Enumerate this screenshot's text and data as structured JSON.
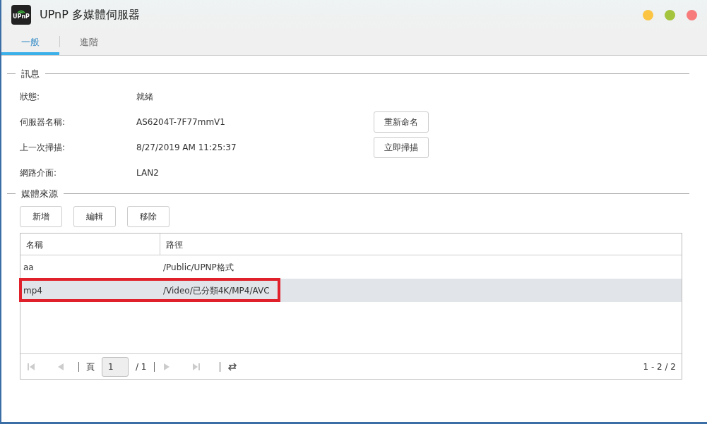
{
  "window": {
    "title": "UPnP 多媒體伺服器",
    "app_icon_text": "UPnP",
    "controls": [
      {
        "color": "#fcc443"
      },
      {
        "color": "#a3c43c"
      },
      {
        "color": "#f77b7b"
      }
    ]
  },
  "tabs": [
    {
      "label": "一般",
      "selected": true
    },
    {
      "label": "進階",
      "selected": false
    }
  ],
  "info": {
    "title": "訊息",
    "rows": [
      {
        "label": "狀態:",
        "value": "就緒"
      },
      {
        "label": "伺服器名稱:",
        "value": "AS6204T-7F77mmV1",
        "button": "重新命名"
      },
      {
        "label": "上一次掃描:",
        "value": "8/27/2019 AM 11:25:37",
        "button": "立即掃描"
      },
      {
        "label": "網路介面:",
        "value": "LAN2"
      }
    ]
  },
  "media_sources": {
    "title": "媒體來源",
    "buttons": [
      "新增",
      "編輯",
      "移除"
    ],
    "table": {
      "columns": [
        "名稱",
        "路徑"
      ],
      "rows": [
        {
          "cells": [
            "aa",
            "/Public/UPNP格式"
          ],
          "selected": false,
          "highlighted": false
        },
        {
          "cells": [
            "mp4",
            "/Video/已分類4K/MP4/AVC"
          ],
          "selected": true,
          "highlighted": true
        }
      ]
    },
    "pager": {
      "page_label": "頁",
      "page": "1",
      "total": "/ 1",
      "range": "1 - 2 / 2"
    }
  }
}
